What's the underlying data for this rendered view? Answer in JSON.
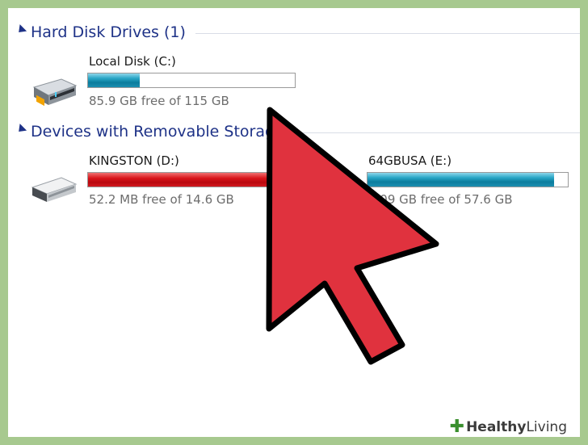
{
  "groups": [
    {
      "title": "Hard Disk Drives (1)"
    },
    {
      "title": "Devices with Removable Storage"
    }
  ],
  "drives": [
    {
      "name": "Local Disk (C:)",
      "free_text": "85.9 GB free of 115 GB",
      "used_fraction": 0.25,
      "bar_color": "#1b8fb0",
      "icon": "hard-disk-icon"
    },
    {
      "name": "KINGSTON (D:)",
      "free_text": "52.2 MB free of 14.6 GB",
      "used_fraction": 0.99,
      "bar_color": "#d0141b",
      "icon": "usb-drive-icon"
    },
    {
      "name": "64GBUSA (E:)",
      "free_text": "4.09 GB free of 57.6 GB",
      "used_fraction": 0.93,
      "bar_color": "#1b8fb0",
      "icon": "usb-drive-icon"
    }
  ],
  "overlay": {
    "arrow_color": "#e0323e",
    "icon": "cursor-arrow-icon"
  },
  "watermark": {
    "text": "Healthy",
    "text_light": "Living"
  }
}
